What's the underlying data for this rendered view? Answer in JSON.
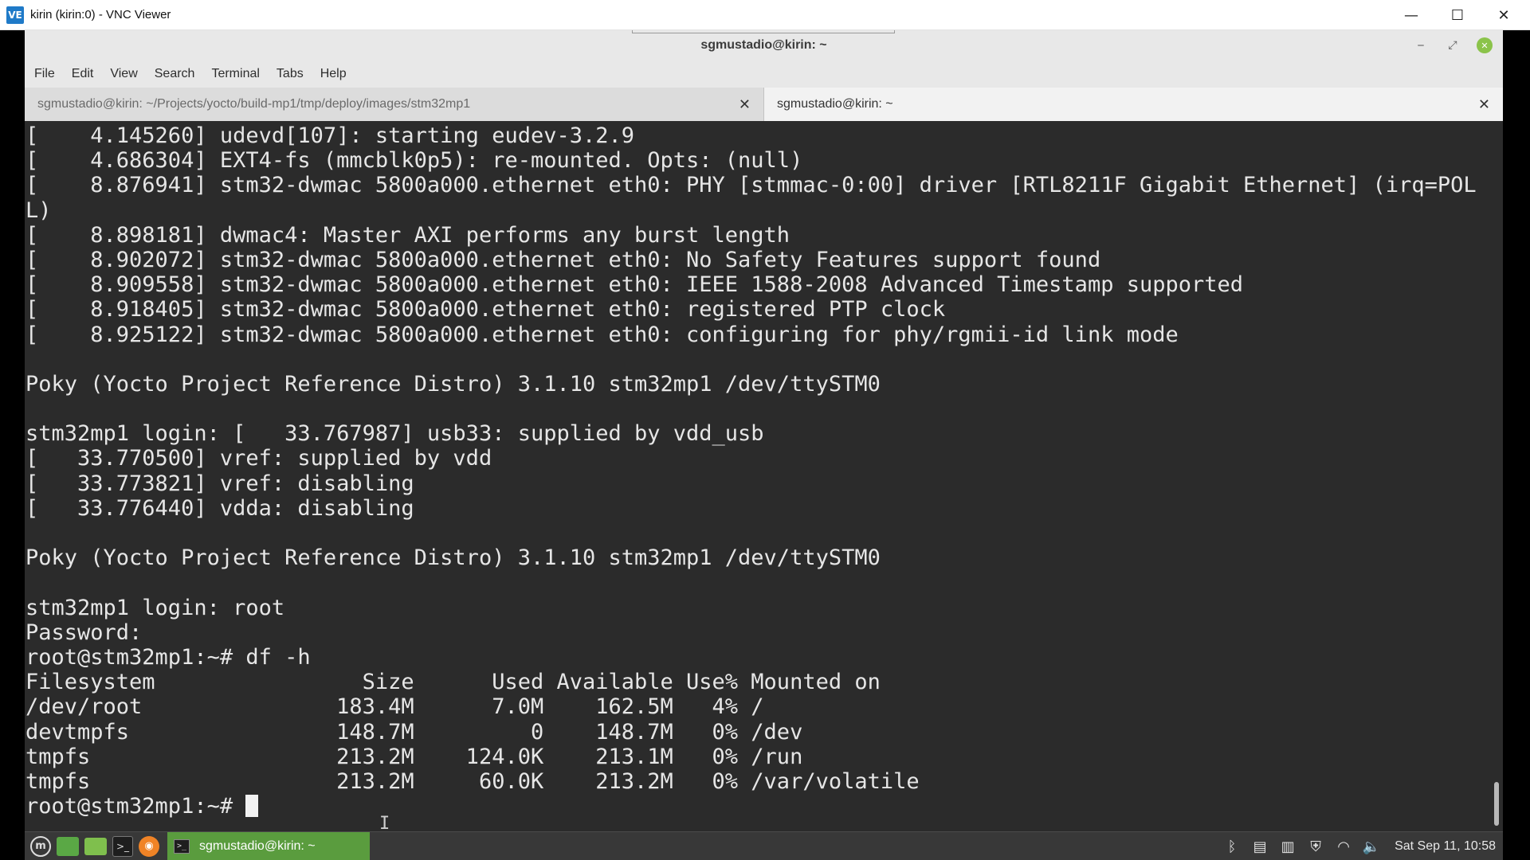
{
  "vnc": {
    "logo": "VE",
    "title": "kirin (kirin:0) - VNC Viewer",
    "minimize_glyph": "—",
    "maximize_glyph": "☐",
    "close_glyph": "✕"
  },
  "terminal_window": {
    "title": "sgmustadio@kirin: ~",
    "minimize_glyph": "‒",
    "maximize_glyph": "⤢",
    "close_glyph": "✕"
  },
  "menu": {
    "items": [
      "File",
      "Edit",
      "View",
      "Search",
      "Terminal",
      "Tabs",
      "Help"
    ]
  },
  "tabs": [
    {
      "label": "sgmustadio@kirin: ~/Projects/yocto/build-mp1/tmp/deploy/images/stm32mp1",
      "active": false
    },
    {
      "label": "sgmustadio@kirin: ~",
      "active": true
    }
  ],
  "tab_close_glyph": "✕",
  "terminal": {
    "lines": [
      "[    4.145260] udevd[107]: starting eudev-3.2.9",
      "[    4.686304] EXT4-fs (mmcblk0p5): re-mounted. Opts: (null)",
      "[    8.876941] stm32-dwmac 5800a000.ethernet eth0: PHY [stmmac-0:00] driver [RTL8211F Gigabit Ethernet] (irq=POL",
      "L)",
      "[    8.898181] dwmac4: Master AXI performs any burst length",
      "[    8.902072] stm32-dwmac 5800a000.ethernet eth0: No Safety Features support found",
      "[    8.909558] stm32-dwmac 5800a000.ethernet eth0: IEEE 1588-2008 Advanced Timestamp supported",
      "[    8.918405] stm32-dwmac 5800a000.ethernet eth0: registered PTP clock",
      "[    8.925122] stm32-dwmac 5800a000.ethernet eth0: configuring for phy/rgmii-id link mode",
      "",
      "Poky (Yocto Project Reference Distro) 3.1.10 stm32mp1 /dev/ttySTM0",
      "",
      "stm32mp1 login: [   33.767987] usb33: supplied by vdd_usb",
      "[   33.770500] vref: supplied by vdd",
      "[   33.773821] vref: disabling",
      "[   33.776440] vdda: disabling",
      "",
      "Poky (Yocto Project Reference Distro) 3.1.10 stm32mp1 /dev/ttySTM0",
      "",
      "stm32mp1 login: root",
      "Password:",
      "root@stm32mp1:~# df -h",
      "Filesystem                Size      Used Available Use% Mounted on",
      "/dev/root               183.4M      7.0M    162.5M   4% /",
      "devtmpfs                148.7M         0    148.7M   0% /dev",
      "tmpfs                   213.2M    124.0K    213.1M   0% /run",
      "tmpfs                   213.2M     60.0K    213.2M   0% /var/volatile"
    ],
    "prompt": "root@stm32mp1:~# "
  },
  "taskbar": {
    "menu_glyph": "m",
    "terminal_glyph": ">_",
    "firefox_glyph": "◉",
    "task_label": "sgmustadio@kirin: ~",
    "task_glyph": ">_",
    "tray": {
      "bluetooth": "ᛒ",
      "clipboard": "▤",
      "updates": "▥",
      "shield": "⛨",
      "network": "◠",
      "volume": "🔈"
    },
    "clock": "Sat Sep 11, 10:58"
  }
}
